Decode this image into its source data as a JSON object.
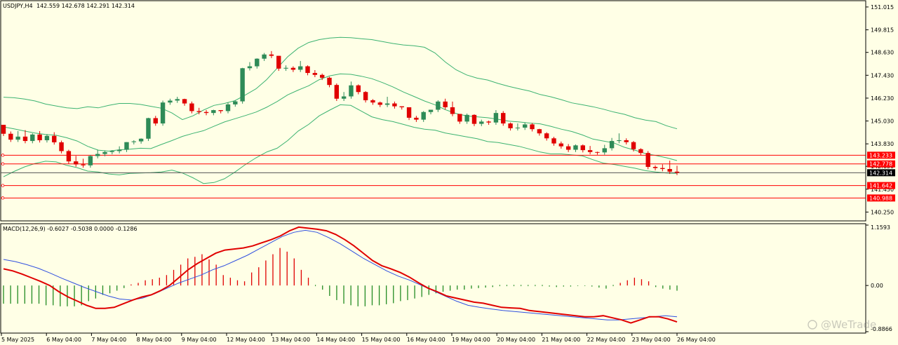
{
  "main_panel": {
    "symbol_label": "USDJPY,H4",
    "ohlc": "142.559 142.678 142.291 142.314",
    "price_scale": {
      "ticks": [
        "151.015",
        "149.815",
        "148.630",
        "147.430",
        "146.230",
        "145.030",
        "143.830",
        "142.650",
        "141.450",
        "140.250"
      ],
      "tick_values": [
        151.015,
        149.815,
        148.63,
        147.43,
        146.23,
        145.03,
        143.83,
        142.65,
        141.45,
        140.25
      ],
      "range": [
        139.86,
        151.27
      ]
    },
    "levels": [
      {
        "label": "143.233",
        "value": 143.233
      },
      {
        "label": "142.778",
        "value": 142.778
      },
      {
        "label": "141.642",
        "value": 141.642
      },
      {
        "label": "140.988",
        "value": 140.988
      }
    ],
    "current_price": {
      "label": "142.314",
      "value": 142.314
    }
  },
  "macd_panel": {
    "label": "MACD(12,26,9) -0.6027 -0.5038 0.0000 -0.1286",
    "scale": {
      "top": "1.1593",
      "zero": "0.00",
      "bottom": "-0.8866"
    },
    "range": [
      -0.8866,
      1.1593
    ]
  },
  "time_axis": {
    "labels": [
      "5 May 2025",
      "6 May 04:00",
      "7 May 04:00",
      "8 May 04:00",
      "9 May 04:00",
      "12 May 04:00",
      "13 May 04:00",
      "14 May 04:00",
      "15 May 04:00",
      "16 May 04:00",
      "19 May 04:00",
      "20 May 04:00",
      "21 May 04:00",
      "22 May 04:00",
      "23 May 04:00",
      "26 May 04:00"
    ]
  },
  "watermark": "@WeTrade",
  "colors": {
    "background": "#ffffe6",
    "bull": "#2e8b57",
    "bear": "#e00000",
    "bands": "#3cb371",
    "level": "#ff0000",
    "macd_line": "#e00000",
    "signal_line": "#3050e0",
    "hist_pos": "#e00000",
    "hist_neg": "#228b22"
  },
  "chart_data": {
    "type": "candlestick",
    "timeframe": "H4",
    "candles_ohc": [
      [
        144.83,
        144.78,
        144.36
      ],
      [
        144.36,
        144.48,
        144.05
      ],
      [
        144.05,
        144.5,
        144.21
      ],
      [
        144.21,
        144.55,
        143.98
      ],
      [
        143.98,
        144.38,
        144.32
      ],
      [
        144.32,
        144.5,
        144.02
      ],
      [
        144.02,
        144.34,
        144.25
      ],
      [
        144.25,
        144.44,
        143.91
      ],
      [
        143.91,
        144.0,
        143.45
      ],
      [
        143.45,
        143.52,
        142.91
      ],
      [
        142.91,
        143.2,
        142.75
      ],
      [
        142.75,
        143.05,
        142.7
      ],
      [
        142.7,
        143.25,
        143.19
      ],
      [
        143.19,
        143.52,
        143.3
      ],
      [
        143.3,
        143.48,
        143.4
      ],
      [
        143.4,
        143.5,
        143.45
      ],
      [
        143.45,
        143.7,
        143.52
      ],
      [
        143.52,
        143.91,
        143.92
      ],
      [
        143.92,
        144.02,
        143.96
      ],
      [
        143.96,
        144.12,
        144.1
      ],
      [
        144.1,
        145.2,
        145.18
      ],
      [
        145.18,
        145.3,
        144.9
      ],
      [
        144.9,
        146.1,
        146.0
      ],
      [
        146.0,
        146.2,
        146.1
      ],
      [
        146.1,
        146.3,
        146.18
      ],
      [
        146.18,
        146.2,
        145.95
      ],
      [
        145.95,
        146.05,
        145.55
      ],
      [
        145.55,
        145.72,
        145.5
      ],
      [
        145.5,
        145.6,
        145.45
      ],
      [
        145.45,
        145.62,
        145.6
      ],
      [
        145.6,
        145.5,
        145.55
      ],
      [
        145.55,
        146.0,
        145.9
      ],
      [
        145.9,
        146.12,
        146.06
      ],
      [
        146.06,
        147.82,
        147.8
      ],
      [
        147.8,
        148.12,
        147.9
      ],
      [
        147.9,
        148.32,
        148.3
      ],
      [
        148.3,
        148.6,
        148.52
      ],
      [
        148.52,
        148.7,
        148.45
      ],
      [
        148.45,
        148.4,
        147.78
      ],
      [
        147.78,
        147.95,
        147.82
      ],
      [
        147.82,
        147.9,
        147.72
      ],
      [
        147.72,
        148.18,
        147.9
      ],
      [
        147.9,
        147.95,
        147.55
      ],
      [
        147.55,
        147.7,
        147.45
      ],
      [
        147.45,
        147.52,
        147.3
      ],
      [
        147.3,
        147.35,
        146.92
      ],
      [
        146.92,
        147.0,
        146.2
      ],
      [
        146.2,
        146.55,
        146.32
      ],
      [
        146.32,
        147.1,
        146.9
      ],
      [
        146.9,
        146.95,
        146.55
      ],
      [
        146.55,
        146.6,
        146.12
      ],
      [
        146.12,
        146.18,
        146.0
      ],
      [
        146.0,
        146.05,
        145.88
      ],
      [
        145.88,
        146.3,
        145.95
      ],
      [
        145.95,
        146.05,
        145.8
      ],
      [
        145.8,
        145.6,
        145.75
      ],
      [
        145.75,
        145.65,
        145.2
      ],
      [
        145.2,
        145.3,
        145.1
      ],
      [
        145.1,
        145.55,
        145.5
      ],
      [
        145.5,
        145.6,
        145.62
      ],
      [
        145.62,
        146.12,
        146.05
      ],
      [
        146.05,
        146.2,
        145.75
      ],
      [
        145.75,
        146.05,
        145.4
      ],
      [
        145.4,
        145.2,
        145.0
      ],
      [
        145.0,
        145.42,
        145.35
      ],
      [
        145.35,
        145.38,
        144.88
      ],
      [
        144.88,
        145.1,
        145.0
      ],
      [
        145.0,
        145.05,
        144.95
      ],
      [
        144.95,
        145.6,
        145.45
      ],
      [
        145.45,
        145.55,
        144.9
      ],
      [
        144.9,
        144.95,
        144.65
      ],
      [
        144.65,
        144.9,
        144.68
      ],
      [
        144.68,
        144.95,
        144.85
      ],
      [
        144.85,
        144.92,
        144.6
      ],
      [
        144.6,
        144.62,
        144.38
      ],
      [
        144.38,
        144.44,
        144.12
      ],
      [
        144.12,
        144.2,
        143.85
      ],
      [
        143.85,
        143.95,
        143.7
      ],
      [
        143.7,
        143.82,
        143.52
      ],
      [
        143.52,
        143.8,
        143.75
      ],
      [
        143.75,
        143.8,
        143.5
      ],
      [
        143.5,
        143.72,
        143.4
      ],
      [
        143.4,
        143.42,
        143.38
      ],
      [
        143.38,
        143.78,
        143.6
      ],
      [
        143.6,
        144.14,
        143.98
      ],
      [
        143.98,
        144.38,
        144.02
      ],
      [
        144.02,
        144.12,
        143.92
      ],
      [
        143.92,
        143.98,
        143.55
      ],
      [
        143.55,
        143.6,
        143.35
      ],
      [
        143.35,
        143.45,
        142.62
      ],
      [
        142.62,
        142.7,
        142.56
      ],
      [
        142.56,
        142.75,
        142.51
      ],
      [
        142.51,
        142.95,
        142.37
      ],
      [
        142.37,
        142.68,
        142.314
      ]
    ],
    "bollinger_upper": [
      146.28,
      146.25,
      146.18,
      146.08,
      145.92,
      145.82,
      145.72,
      145.68,
      145.78,
      145.72,
      145.85,
      145.95,
      145.95,
      145.9,
      145.8,
      145.7,
      145.45,
      145.1,
      145.3,
      145.6,
      145.85,
      145.95,
      146.1,
      146.4,
      146.72,
      147.2,
      147.8,
      148.4,
      148.85,
      149.15,
      149.3,
      149.38,
      149.42,
      149.4,
      149.35,
      149.3,
      149.2,
      149.1,
      149.02,
      148.98,
      148.9,
      148.6,
      148.12,
      147.72,
      147.45,
      147.28,
      147.18,
      147.0,
      146.85,
      146.72,
      146.6,
      146.42,
      146.3,
      146.15,
      145.98,
      145.88,
      145.78,
      145.65,
      145.5,
      145.38,
      145.2,
      145.08,
      145.0,
      144.78,
      144.62
    ],
    "bollinger_mid": [
      144.72,
      144.62,
      144.5,
      144.4,
      144.32,
      144.28,
      144.15,
      143.98,
      143.7,
      143.5,
      143.45,
      143.52,
      143.55,
      143.6,
      143.58,
      143.8,
      144.0,
      144.22,
      144.38,
      144.52,
      144.75,
      144.98,
      145.15,
      145.32,
      145.5,
      145.75,
      146.05,
      146.4,
      146.65,
      146.88,
      147.2,
      147.4,
      147.5,
      147.48,
      147.38,
      147.25,
      147.05,
      146.82,
      146.55,
      146.32,
      146.08,
      145.88,
      145.62,
      145.42,
      145.3,
      145.25,
      145.2,
      145.12,
      145.02,
      144.98,
      144.92,
      144.88,
      144.75,
      144.6,
      144.48,
      144.3,
      144.08,
      143.98,
      143.88,
      143.65,
      143.5,
      143.32,
      143.22,
      143.1,
      142.95
    ],
    "bollinger_lower": [
      142.1,
      142.38,
      142.62,
      142.8,
      142.92,
      142.88,
      142.7,
      142.58,
      142.4,
      142.35,
      142.25,
      142.2,
      142.28,
      142.3,
      142.32,
      142.35,
      142.45,
      142.3,
      142.05,
      141.75,
      141.8,
      142.0,
      142.35,
      142.75,
      143.1,
      143.4,
      143.6,
      144.0,
      144.5,
      144.85,
      145.3,
      145.6,
      145.88,
      145.85,
      145.55,
      145.25,
      145.1,
      145.0,
      144.85,
      144.7,
      144.6,
      144.55,
      144.4,
      144.3,
      144.2,
      144.1,
      143.95,
      143.9,
      143.8,
      143.7,
      143.55,
      143.4,
      143.3,
      143.3,
      143.25,
      143.2,
      143.0,
      142.82,
      142.75,
      142.65,
      142.55,
      142.42,
      142.35,
      142.3,
      142.28
    ],
    "macd_line": [
      0.32,
      0.28,
      0.22,
      0.15,
      0.08,
      0.0,
      -0.12,
      -0.22,
      -0.3,
      -0.38,
      -0.44,
      -0.44,
      -0.42,
      -0.35,
      -0.28,
      -0.22,
      -0.18,
      -0.1,
      0.0,
      0.15,
      0.3,
      0.42,
      0.52,
      0.62,
      0.68,
      0.7,
      0.72,
      0.76,
      0.82,
      0.88,
      0.95,
      1.05,
      1.12,
      1.1,
      1.08,
      1.05,
      0.98,
      0.88,
      0.76,
      0.62,
      0.48,
      0.38,
      0.32,
      0.25,
      0.16,
      0.05,
      -0.05,
      -0.12,
      -0.2,
      -0.24,
      -0.28,
      -0.32,
      -0.34,
      -0.38,
      -0.42,
      -0.43,
      -0.44,
      -0.48,
      -0.5,
      -0.52,
      -0.54,
      -0.56,
      -0.58,
      -0.6,
      -0.6,
      -0.58,
      -0.62,
      -0.66,
      -0.72,
      -0.66,
      -0.6,
      -0.6,
      -0.64,
      -0.7
    ],
    "signal_line": [
      0.5,
      0.46,
      0.4,
      0.33,
      0.24,
      0.14,
      0.05,
      -0.04,
      -0.12,
      -0.2,
      -0.26,
      -0.28,
      -0.24,
      -0.16,
      -0.06,
      0.04,
      0.12,
      0.2,
      0.3,
      0.38,
      0.48,
      0.58,
      0.7,
      0.82,
      0.94,
      1.02,
      1.06,
      1.02,
      0.92,
      0.8,
      0.66,
      0.52,
      0.4,
      0.28,
      0.18,
      0.1,
      0.0,
      -0.1,
      -0.2,
      -0.3,
      -0.38,
      -0.42,
      -0.45,
      -0.48,
      -0.5,
      -0.52,
      -0.54,
      -0.56,
      -0.58,
      -0.6,
      -0.62,
      -0.64,
      -0.66,
      -0.66,
      -0.64,
      -0.62,
      -0.6,
      -0.58,
      -0.6
    ],
    "histogram": [
      -0.35,
      -0.35,
      -0.35,
      -0.35,
      -0.35,
      -0.35,
      -0.38,
      -0.38,
      -0.4,
      -0.4,
      -0.4,
      -0.38,
      -0.3,
      -0.25,
      -0.18,
      -0.15,
      -0.1,
      -0.05,
      0.02,
      0.05,
      0.1,
      0.12,
      0.15,
      0.2,
      0.3,
      0.4,
      0.52,
      0.55,
      0.6,
      0.5,
      0.4,
      0.2,
      0.15,
      0.1,
      0.08,
      0.25,
      0.35,
      0.48,
      0.6,
      0.72,
      0.65,
      0.52,
      0.3,
      0.15,
      0.0,
      -0.08,
      -0.2,
      -0.28,
      -0.35,
      -0.38,
      -0.4,
      -0.4,
      -0.38,
      -0.38,
      -0.36,
      -0.34,
      -0.3,
      -0.28,
      -0.25,
      -0.22,
      -0.18,
      -0.15,
      -0.12,
      -0.1,
      -0.08,
      -0.08,
      -0.06,
      -0.05,
      -0.04,
      -0.03,
      0.0,
      0.0,
      0.0,
      0.0,
      0.0,
      0.0,
      0.0,
      -0.02,
      -0.03,
      -0.02,
      -0.02,
      -0.01,
      -0.01,
      -0.02,
      -0.04,
      -0.06,
      0.0,
      0.05,
      0.1,
      0.15,
      0.12,
      0.08,
      -0.03,
      -0.06,
      -0.08,
      -0.1
    ]
  }
}
